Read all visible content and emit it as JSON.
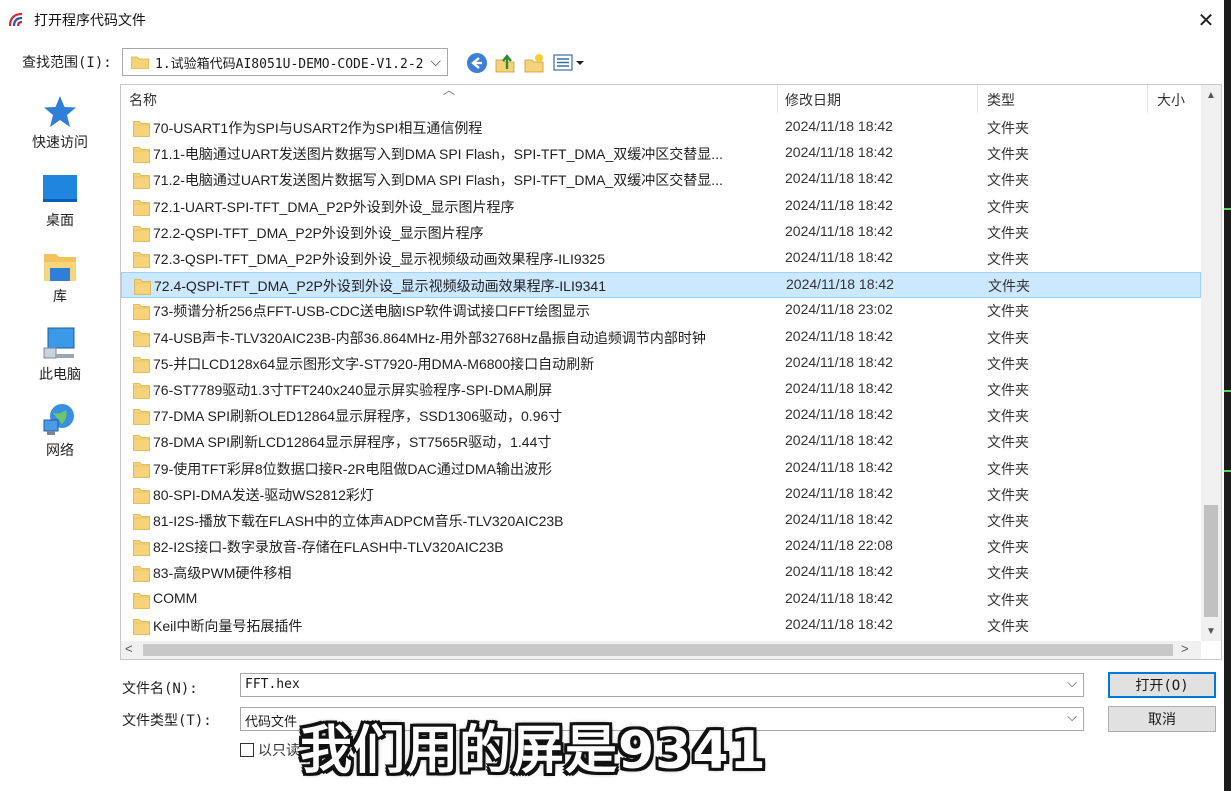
{
  "window": {
    "title": "打开程序代码文件",
    "close_glyph": "✕"
  },
  "lookin": {
    "label": "查找范围(I):",
    "value": "1.试验箱代码AI8051U-DEMO-CODE-V1.2-2"
  },
  "toolbar": {
    "icons": [
      "back-icon",
      "up-folder-icon",
      "new-folder-icon",
      "view-menu-icon"
    ]
  },
  "places": [
    {
      "label": "快速访问",
      "icon": "star-icon"
    },
    {
      "label": "桌面",
      "icon": "desktop-icon"
    },
    {
      "label": "库",
      "icon": "library-icon"
    },
    {
      "label": "此电脑",
      "icon": "computer-icon"
    },
    {
      "label": "网络",
      "icon": "network-icon"
    }
  ],
  "list": {
    "columns": {
      "name": "名称",
      "date": "修改日期",
      "type": "类型",
      "size": "大小"
    },
    "rows": [
      {
        "name": "70-USART1作为SPI与USART2作为SPI相互通信例程",
        "date": "2024/11/18 18:42",
        "type": "文件夹"
      },
      {
        "name": "71.1-电脑通过UART发送图片数据写入到DMA SPI Flash，SPI-TFT_DMA_双缓冲区交替显...",
        "date": "2024/11/18 18:42",
        "type": "文件夹"
      },
      {
        "name": "71.2-电脑通过UART发送图片数据写入到DMA SPI Flash，SPI-TFT_DMA_双缓冲区交替显...",
        "date": "2024/11/18 18:42",
        "type": "文件夹"
      },
      {
        "name": "72.1-UART-SPI-TFT_DMA_P2P外设到外设_显示图片程序",
        "date": "2024/11/18 18:42",
        "type": "文件夹"
      },
      {
        "name": "72.2-QSPI-TFT_DMA_P2P外设到外设_显示图片程序",
        "date": "2024/11/18 18:42",
        "type": "文件夹"
      },
      {
        "name": "72.3-QSPI-TFT_DMA_P2P外设到外设_显示视频级动画效果程序-ILI9325",
        "date": "2024/11/18 18:42",
        "type": "文件夹"
      },
      {
        "name": "72.4-QSPI-TFT_DMA_P2P外设到外设_显示视频级动画效果程序-ILI9341",
        "date": "2024/11/18 18:42",
        "type": "文件夹",
        "selected": true
      },
      {
        "name": "73-频谱分析256点FFT-USB-CDC送电脑ISP软件调试接口FFT绘图显示",
        "date": "2024/11/18 23:02",
        "type": "文件夹"
      },
      {
        "name": "74-USB声卡-TLV320AIC23B-内部36.864MHz-用外部32768Hz晶振自动追频调节内部时钟",
        "date": "2024/11/18 18:42",
        "type": "文件夹"
      },
      {
        "name": "75-并口LCD128x64显示图形文字-ST7920-用DMA-M6800接口自动刷新",
        "date": "2024/11/18 18:42",
        "type": "文件夹"
      },
      {
        "name": "76-ST7789驱动1.3寸TFT240x240显示屏实验程序-SPI-DMA刷屏",
        "date": "2024/11/18 18:42",
        "type": "文件夹"
      },
      {
        "name": "77-DMA SPI刷新OLED12864显示屏程序，SSD1306驱动，0.96寸",
        "date": "2024/11/18 18:42",
        "type": "文件夹"
      },
      {
        "name": "78-DMA SPI刷新LCD12864显示屏程序，ST7565R驱动，1.44寸",
        "date": "2024/11/18 18:42",
        "type": "文件夹"
      },
      {
        "name": "79-使用TFT彩屏8位数据口接R-2R电阻做DAC通过DMA输出波形",
        "date": "2024/11/18 18:42",
        "type": "文件夹"
      },
      {
        "name": "80-SPI-DMA发送-驱动WS2812彩灯",
        "date": "2024/11/18 18:42",
        "type": "文件夹"
      },
      {
        "name": "81-I2S-播放下载在FLASH中的立体声ADPCM音乐-TLV320AIC23B",
        "date": "2024/11/18 18:42",
        "type": "文件夹"
      },
      {
        "name": "82-I2S接口-数字录放音-存储在FLASH中-TLV320AIC23B",
        "date": "2024/11/18 22:08",
        "type": "文件夹"
      },
      {
        "name": "83-高级PWM硬件移相",
        "date": "2024/11/18 18:42",
        "type": "文件夹"
      },
      {
        "name": "COMM",
        "date": "2024/11/18 18:42",
        "type": "文件夹"
      },
      {
        "name": "Keil中断向量号拓展插件",
        "date": "2024/11/18 18:42",
        "type": "文件夹"
      }
    ]
  },
  "filename": {
    "label": "文件名(N):",
    "value": "FFT.hex"
  },
  "filetype": {
    "label": "文件类型(T):",
    "value": "代码文件"
  },
  "readonly": {
    "label": "以只读"
  },
  "buttons": {
    "open": "打开(O)",
    "cancel": "取消"
  },
  "subtitle": "我们用的屏是9341",
  "colors": {
    "selection": "#cce8ff",
    "folder": "#f6d37b",
    "accent": "#0078d7"
  }
}
